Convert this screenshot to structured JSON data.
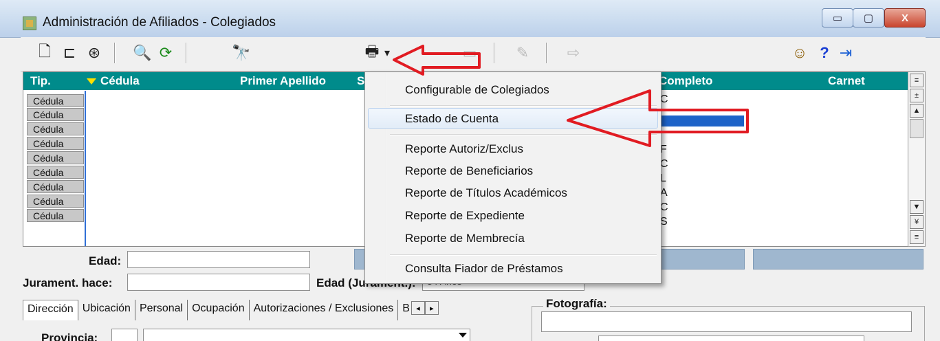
{
  "window": {
    "title": "Administración de Afiliados - Colegiados",
    "minimize_glyph": "▭",
    "maximize_glyph": "▢",
    "close_glyph": "X"
  },
  "toolbar": {
    "icons": [
      "new-document-icon",
      "tree-icon",
      "globe-icon",
      "search-binoculars-icon",
      "refresh-icon",
      "find-icon",
      "printer-icon",
      "dropdown-arrow-icon",
      "save-icon",
      "edit-icon",
      "export-icon",
      "user-icon",
      "help-icon",
      "exit-door-icon"
    ],
    "glyphs": {
      "new": "🗋",
      "tree": "⊏",
      "globe": "⊛",
      "search": "🔍",
      "refresh": "⟳",
      "find": "🔭",
      "printer": "🖶",
      "dropdown": "▾",
      "save": "▭",
      "edit": "✎",
      "export": "⇨",
      "user": "☺",
      "help": "?",
      "exit": "⇥"
    }
  },
  "grid": {
    "columns": [
      "Tip.",
      "Cédula",
      "Primer Apellido",
      "S",
      "Completo",
      "Carnet"
    ],
    "row_type_label": "Cédula",
    "rows": [
      "Cédula",
      "Cédula",
      "Cédula",
      "Cédula",
      "Cédula",
      "Cédula",
      "Cédula",
      "Cédula",
      "Cédula"
    ],
    "visible_fragments": [
      "C",
      "F",
      "C",
      "L",
      "A",
      "C",
      "S"
    ]
  },
  "scrollbar": {
    "glyphs": [
      "≡",
      "±",
      "▲",
      "▼",
      "¥",
      "≡"
    ]
  },
  "form": {
    "edad_label": "Edad:",
    "edad_value": "",
    "jurament_label": "Jurament. hace:",
    "jurament_value": "",
    "edad_jurament_label": "Edad (Jurament.):",
    "edad_jurament_value": "34 Años",
    "provincia_label": "Provincia:",
    "foto_label": "Fotografía:"
  },
  "tabs": [
    "Dirección",
    "Ubicación",
    "Personal",
    "Ocupación",
    "Autorizaciones / Exclusiones",
    "B"
  ],
  "tab_scroll": [
    "◂",
    "▸"
  ],
  "menu": {
    "items": [
      "Configurable de Colegiados",
      "Estado de Cuenta",
      "Reporte Autoriz/Exclus",
      "Reporte de Beneficiarios",
      "Reporte de Títulos Académicos",
      "Reporte de Expediente",
      "Reporte de Membrecía",
      "Consulta Fiador de Préstamos"
    ],
    "highlighted": "Estado de Cuenta"
  },
  "colors": {
    "grid_header": "#008b8b",
    "annotation_red": "#e11b22",
    "sort_arrow": "#ffe000"
  }
}
